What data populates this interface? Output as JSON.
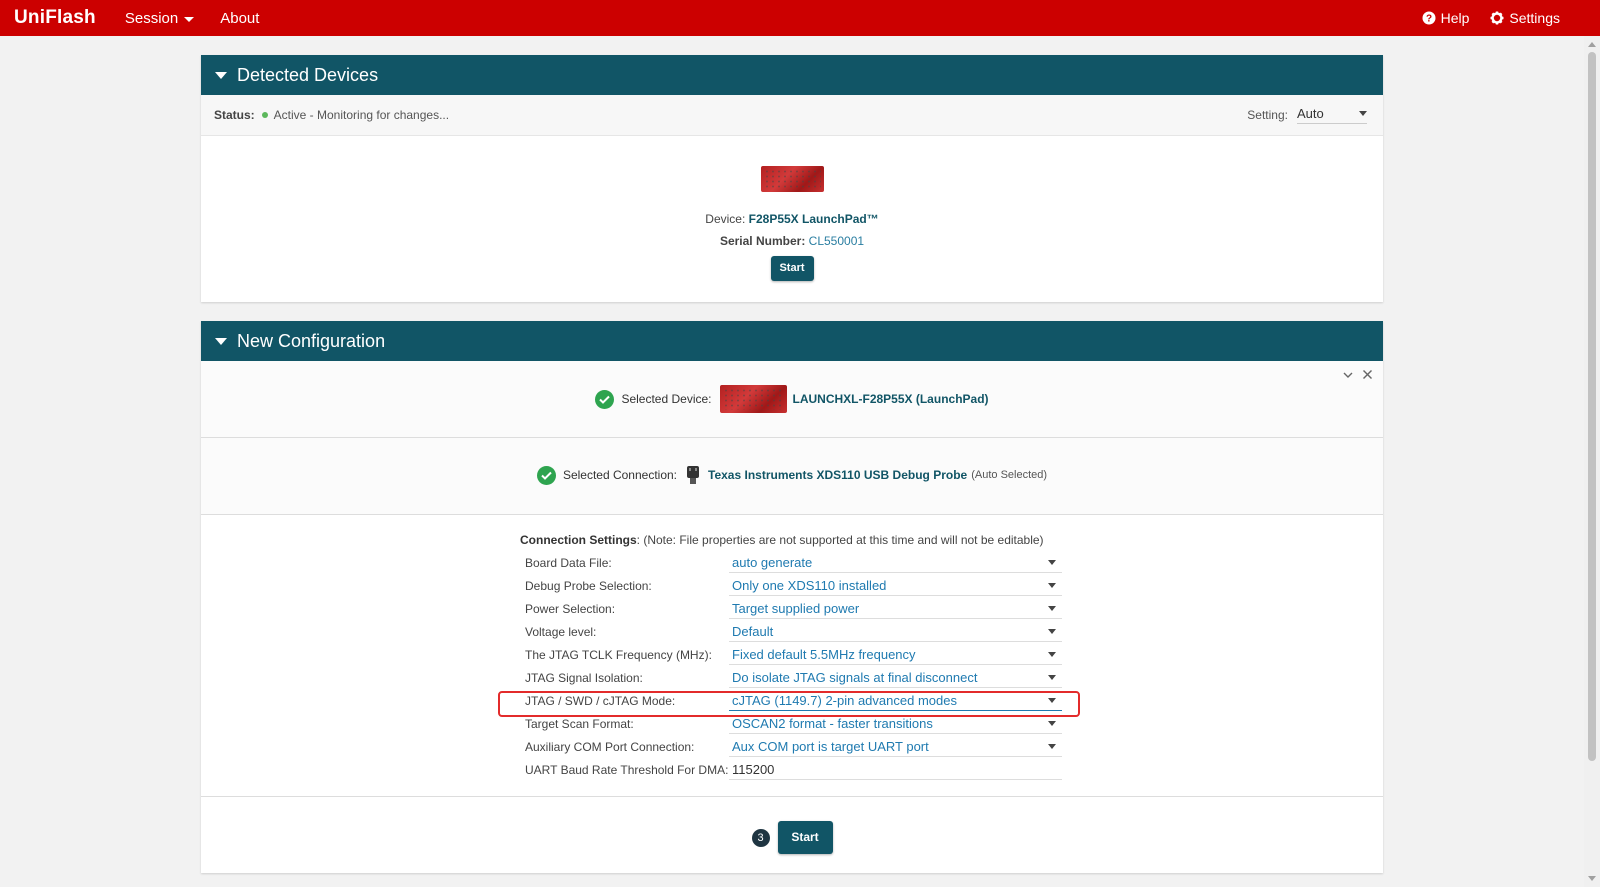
{
  "app": {
    "brand": "UniFlash",
    "menus": [
      {
        "label": "Session"
      },
      {
        "label": "About"
      }
    ],
    "help_label": "Help",
    "settings_label": "Settings"
  },
  "detected_devices": {
    "title": "Detected Devices",
    "status_label": "Status:",
    "status_text": "Active - Monitoring for changes...",
    "setting_label": "Setting:",
    "setting_value": "Auto",
    "device_label": "Device:",
    "device_name": "F28P55X LaunchPad™",
    "serial_label": "Serial Number:",
    "serial_value": "CL550001",
    "start_label": "Start"
  },
  "new_configuration": {
    "title": "New Configuration",
    "selected_device_label": "Selected Device:",
    "selected_device_value": "LAUNCHXL-F28P55X (LaunchPad)",
    "selected_connection_label": "Selected Connection:",
    "selected_connection_value": "Texas Instruments XDS110 USB Debug Probe",
    "selected_connection_note": "(Auto Selected)",
    "settings_title": "Connection Settings",
    "settings_note": ": (Note: File properties are not supported at this time and will not be editable)",
    "settings": [
      {
        "label": "Board Data File:",
        "value": "auto generate"
      },
      {
        "label": "Debug Probe Selection:",
        "value": "Only one XDS110 installed"
      },
      {
        "label": "Power Selection:",
        "value": "Target supplied power"
      },
      {
        "label": "Voltage level:",
        "value": "Default"
      },
      {
        "label": "The JTAG TCLK Frequency (MHz):",
        "value": "Fixed default 5.5MHz frequency"
      },
      {
        "label": "JTAG Signal Isolation:",
        "value": "Do isolate JTAG signals at final disconnect"
      },
      {
        "label": "JTAG / SWD / cJTAG Mode:",
        "value": "cJTAG (1149.7) 2-pin advanced modes"
      },
      {
        "label": "Target Scan Format:",
        "value": "OSCAN2 format - faster transitions"
      },
      {
        "label": "Auxiliary COM Port Connection:",
        "value": "Aux COM port is target UART port"
      },
      {
        "label": "UART Baud Rate Threshold For DMA:",
        "value": "115200"
      }
    ],
    "step_number": "3",
    "start_label": "Start"
  },
  "colors": {
    "topbar": "#cc0000",
    "panel_header": "#115566",
    "accent_link": "#1f7ab0",
    "success": "#2ea44f",
    "highlight": "#e32b2b"
  }
}
